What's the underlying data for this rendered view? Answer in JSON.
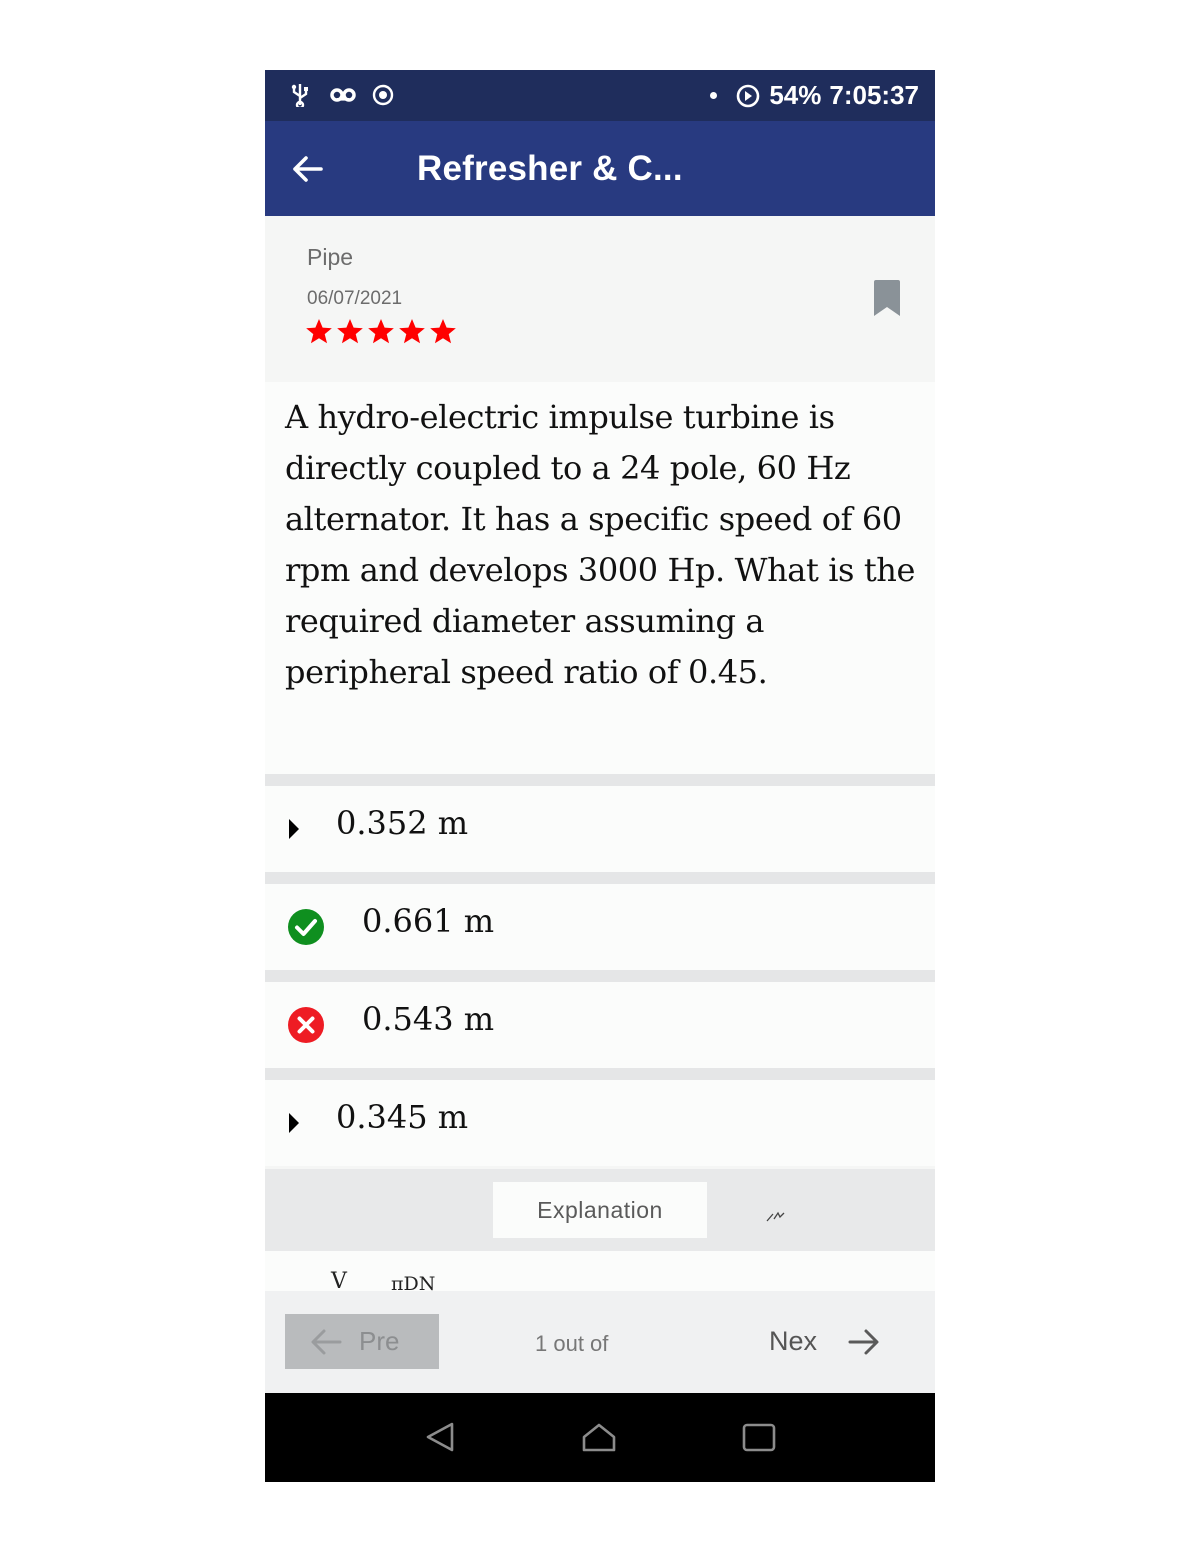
{
  "status_bar": {
    "icons": [
      "usb-icon",
      "voicemail-icon",
      "record-icon",
      "notification-dot",
      "data-saver-icon"
    ],
    "battery": "54%",
    "time": "7:05:37"
  },
  "app_bar": {
    "title": "Refresher & C..."
  },
  "meta": {
    "subject": "Pipe",
    "date": "06/07/2021",
    "rating": 5,
    "rating_max": 5,
    "star_color": "#ff0000"
  },
  "question": {
    "text": "A hydro-electric impulse turbine is directly coupled to a 24 pole, 60 Hz alternator. It has a specific  speed of 60 rpm and develops 3000 Hp. What is the required diameter assuming a peripheral speed ratio of 0.45."
  },
  "options": [
    {
      "text": "0.352 m",
      "state": "neutral"
    },
    {
      "text": "0.661 m",
      "state": "correct"
    },
    {
      "text": "0.543 m",
      "state": "wrong"
    },
    {
      "text": "0.345 m",
      "state": "neutral"
    }
  ],
  "colors": {
    "status_bar": "#1f2d5c",
    "app_bar": "#283a80",
    "correct": "#0f8f1f",
    "wrong": "#ee1c24"
  },
  "explanation": {
    "button_label": "Explanation",
    "formula_peek_v": "V",
    "formula_peek_pidn": "πDN"
  },
  "pager": {
    "prev_label": "Pre",
    "count_text": "1 out of",
    "next_label": "Nex"
  }
}
